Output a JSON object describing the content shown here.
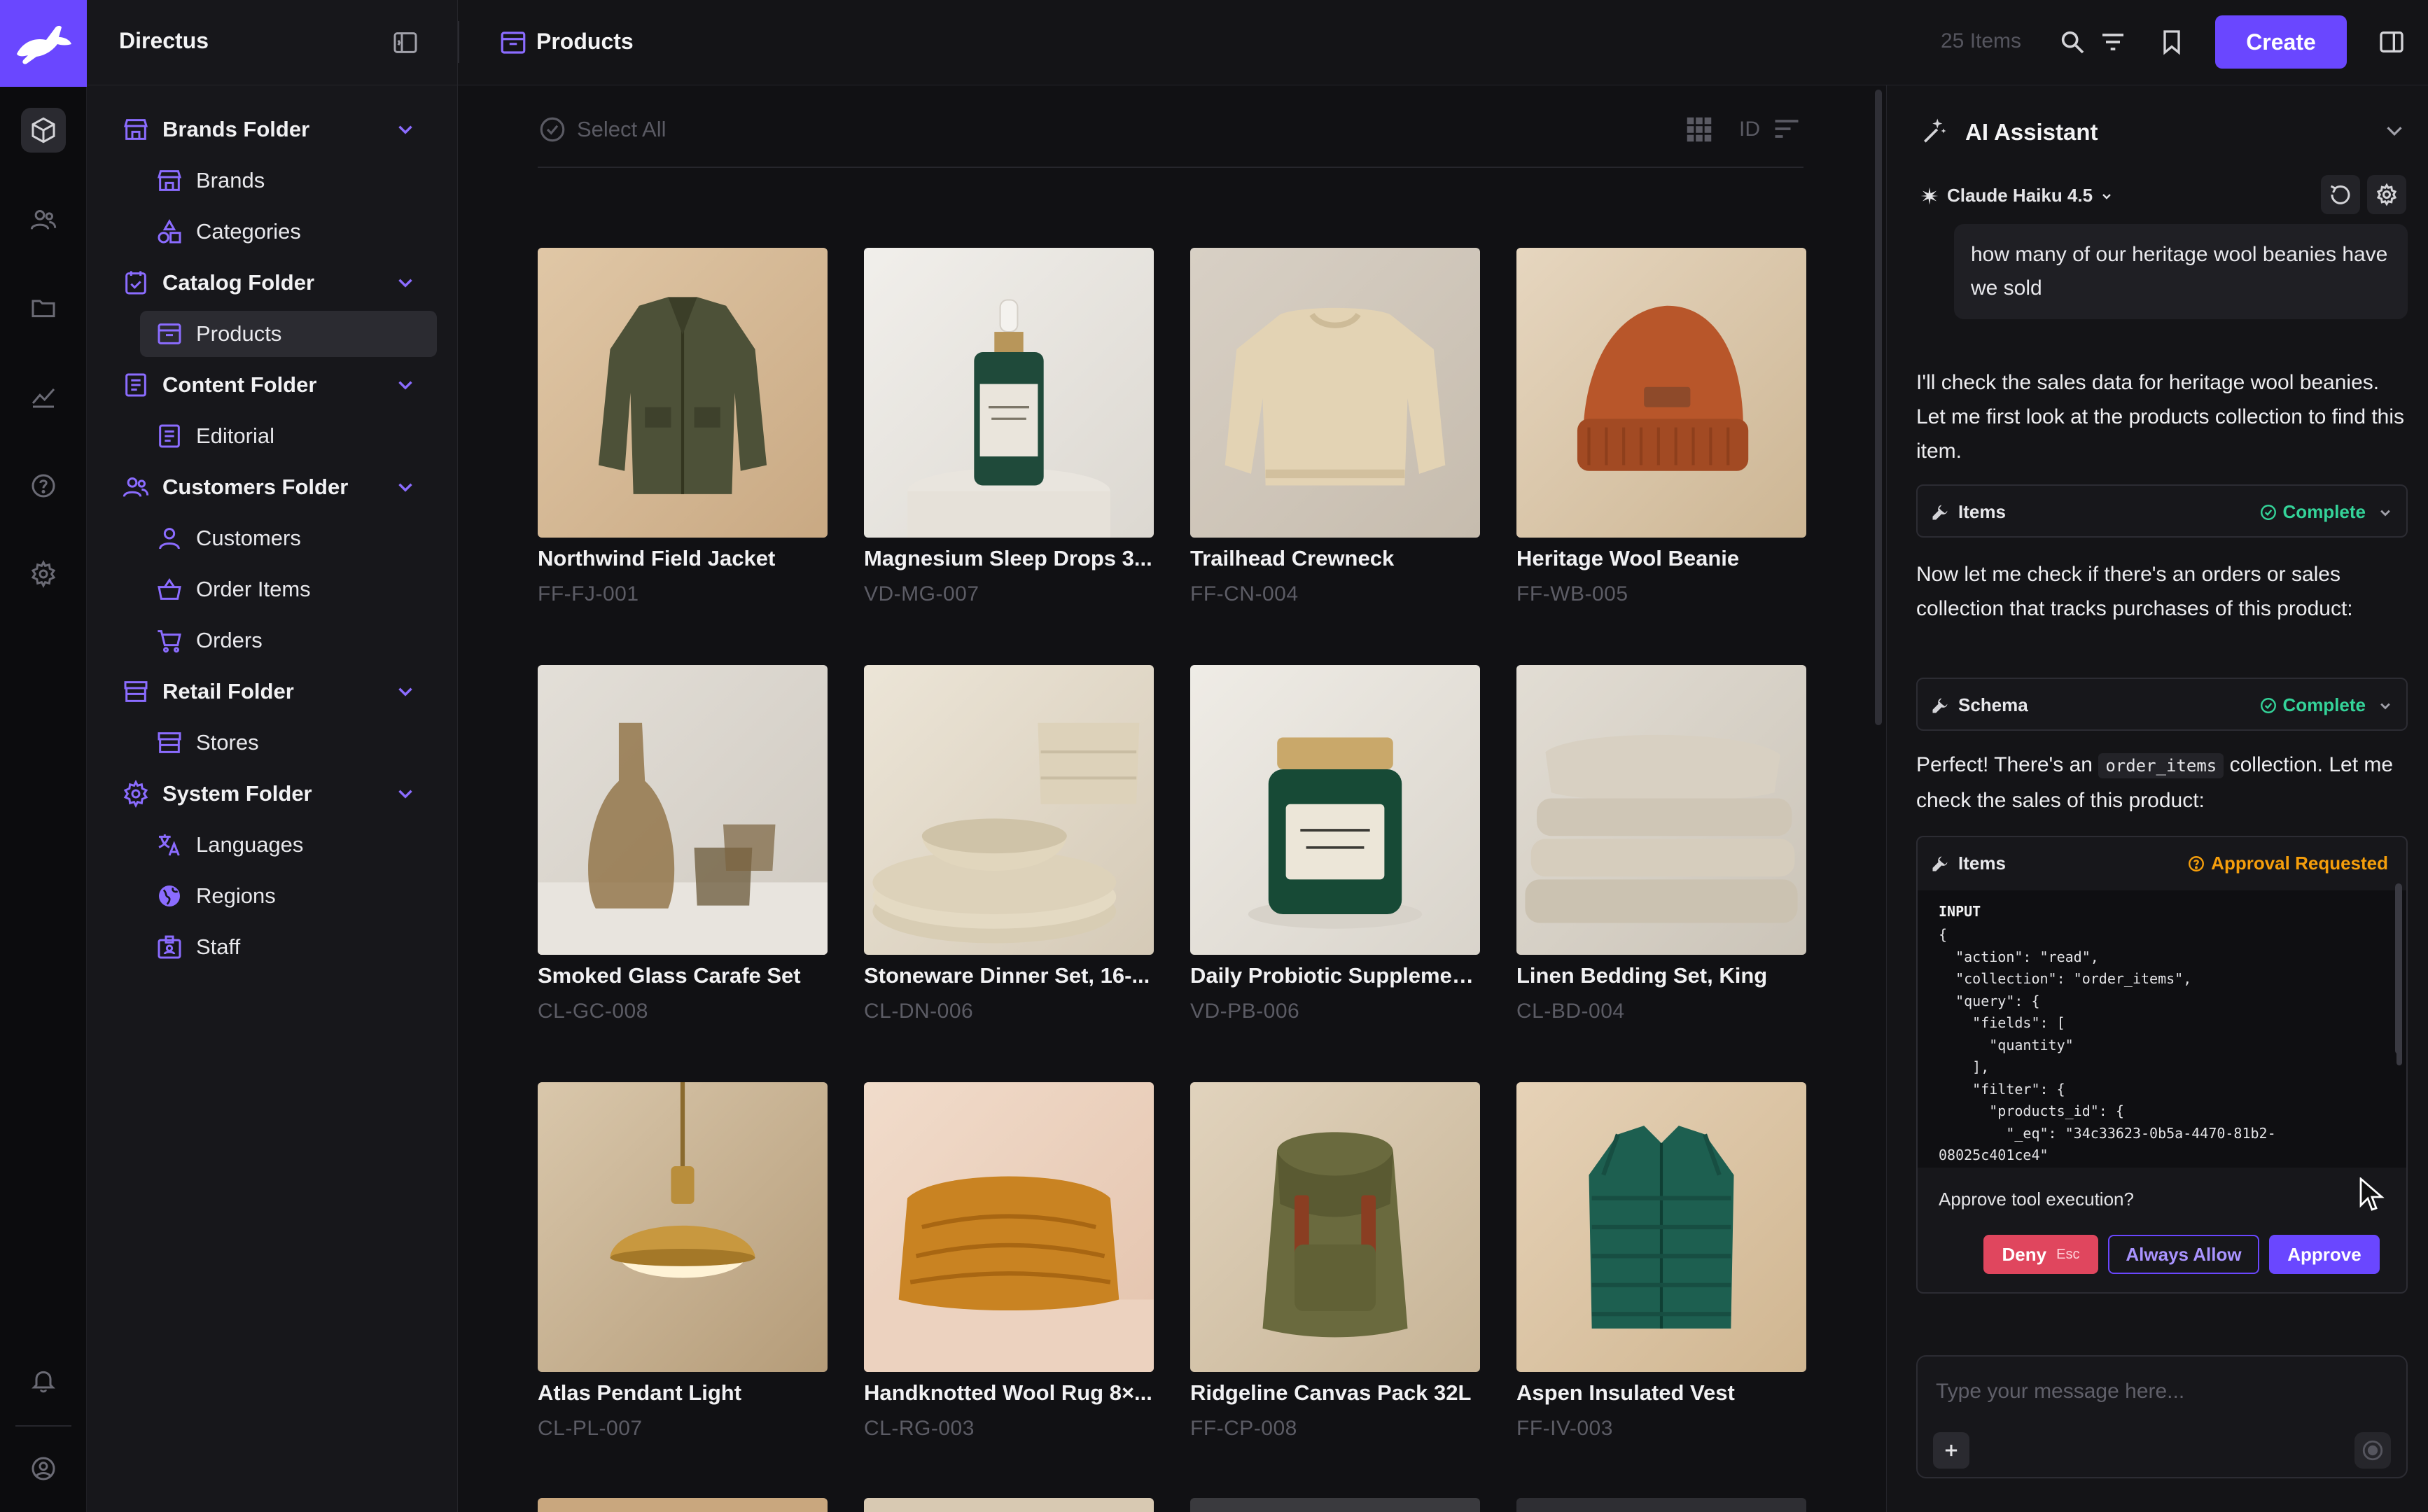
{
  "app": {
    "name": "Directus"
  },
  "navigation": [
    {
      "type": "folder",
      "label": "Brands Folder",
      "icon": "storefront-icon"
    },
    {
      "type": "child",
      "label": "Brands",
      "icon": "storefront-icon"
    },
    {
      "type": "child",
      "label": "Categories",
      "icon": "shapes-icon"
    },
    {
      "type": "folder",
      "label": "Catalog Folder",
      "icon": "catalog-icon"
    },
    {
      "type": "child",
      "label": "Products",
      "icon": "archive-icon",
      "active": true
    },
    {
      "type": "folder",
      "label": "Content Folder",
      "icon": "article-icon"
    },
    {
      "type": "child",
      "label": "Editorial",
      "icon": "article-icon"
    },
    {
      "type": "folder",
      "label": "Customers Folder",
      "icon": "group-icon"
    },
    {
      "type": "child",
      "label": "Customers",
      "icon": "person-icon"
    },
    {
      "type": "child",
      "label": "Order Items",
      "icon": "basket-icon"
    },
    {
      "type": "child",
      "label": "Orders",
      "icon": "cart-icon"
    },
    {
      "type": "folder",
      "label": "Retail Folder",
      "icon": "store-icon"
    },
    {
      "type": "child",
      "label": "Stores",
      "icon": "store-icon"
    },
    {
      "type": "folder",
      "label": "System Folder",
      "icon": "settings-icon"
    },
    {
      "type": "child",
      "label": "Languages",
      "icon": "translate-icon"
    },
    {
      "type": "child",
      "label": "Regions",
      "icon": "globe-icon"
    },
    {
      "type": "child",
      "label": "Staff",
      "icon": "badge-icon"
    }
  ],
  "header": {
    "collection_title": "Products",
    "item_count": "25 Items",
    "create_label": "Create"
  },
  "toolbar": {
    "select_all_label": "Select All",
    "sort_field": "ID"
  },
  "products": [
    {
      "title": "Northwind Field Jacket",
      "sku": "FF-FJ-001",
      "image": "jacket"
    },
    {
      "title": "Magnesium Sleep Drops 3...",
      "sku": "VD-MG-007",
      "image": "dropper-bottle"
    },
    {
      "title": "Trailhead Crewneck",
      "sku": "FF-CN-004",
      "image": "sweater"
    },
    {
      "title": "Heritage Wool Beanie",
      "sku": "FF-WB-005",
      "image": "beanie"
    },
    {
      "title": "Smoked Glass Carafe Set",
      "sku": "CL-GC-008",
      "image": "carafe"
    },
    {
      "title": "Stoneware Dinner Set, 16-...",
      "sku": "CL-DN-006",
      "image": "dinnerware"
    },
    {
      "title": "Daily Probiotic Supplemen...",
      "sku": "VD-PB-006",
      "image": "jar"
    },
    {
      "title": "Linen Bedding Set, King",
      "sku": "CL-BD-004",
      "image": "bedding"
    },
    {
      "title": "Atlas Pendant Light",
      "sku": "CL-PL-007",
      "image": "pendant-light"
    },
    {
      "title": "Handknotted Wool Rug 8×...",
      "sku": "CL-RG-003",
      "image": "rug"
    },
    {
      "title": "Ridgeline Canvas Pack 32L",
      "sku": "FF-CP-008",
      "image": "backpack"
    },
    {
      "title": "Aspen Insulated Vest",
      "sku": "FF-IV-003",
      "image": "vest"
    }
  ],
  "assistant": {
    "title": "AI Assistant",
    "model": "Claude Haiku 4.5",
    "user_message": "how many of our heritage wool beanies have we sold",
    "reply_1": "I'll check the sales data for heritage wool beanies. Let me first look at the products collection to find this item.",
    "tool_1": {
      "name": "Items",
      "status": "Complete"
    },
    "reply_2": "Now let me check if there's an orders or sales collection that tracks purchases of this product:",
    "tool_2": {
      "name": "Schema",
      "status": "Complete"
    },
    "reply_3_before": "Perfect! There's an",
    "reply_3_code": "order_items",
    "reply_3_after": "collection. Let me check the sales of this product:",
    "tool_3": {
      "name": "Items",
      "status": "Approval Requested",
      "input_label": "INPUT",
      "input_code": "{\n  \"action\": \"read\",\n  \"collection\": \"order_items\",\n  \"query\": {\n    \"fields\": [\n      \"quantity\"\n    ],\n    \"filter\": {\n      \"products_id\": {\n        \"_eq\": \"34c33623-0b5a-4470-81b2-\n08025c401ce4\""
    },
    "approve_question": "Approve tool execution?",
    "deny_label": "Deny",
    "deny_key": "Esc",
    "always_allow_label": "Always Allow",
    "approve_label": "Approve",
    "composer_placeholder": "Type your message here..."
  },
  "colors": {
    "accent": "#6a47ff",
    "success": "#34d399",
    "warning": "#f59e0b",
    "danger": "#e0465e",
    "nav_icon": "#8b6cff"
  }
}
